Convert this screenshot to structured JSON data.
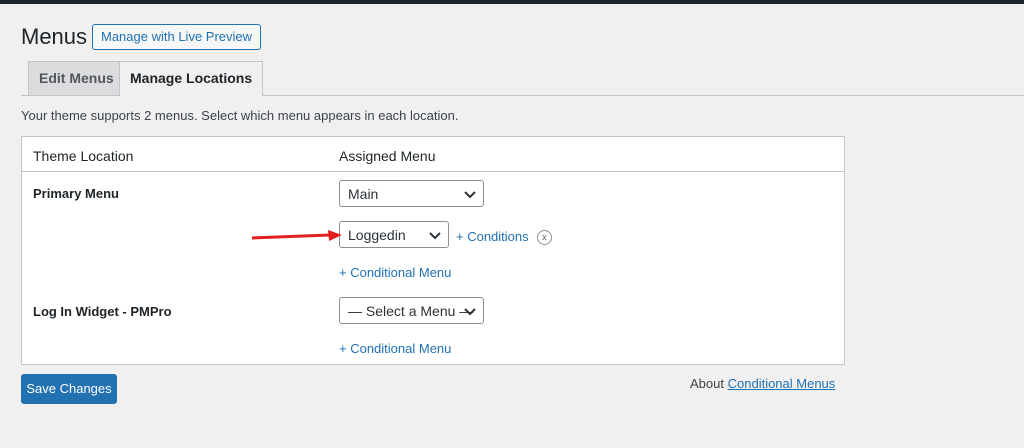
{
  "header": {
    "title": "Menus",
    "live_preview_label": "Manage with Live Preview"
  },
  "tabs": [
    {
      "label": "Edit Menus",
      "active": false
    },
    {
      "label": "Manage Locations",
      "active": true
    }
  ],
  "description": "Your theme supports 2 menus. Select which menu appears in each location.",
  "table": {
    "col_location": "Theme Location",
    "col_assigned": "Assigned Menu",
    "rows": [
      {
        "location": "Primary Menu",
        "selected_menu": "Main",
        "conditional": {
          "selected_menu": "Loggedin",
          "conditions_label": "+ Conditions",
          "remove_label": "x"
        },
        "add_conditional_label": "+ Conditional Menu"
      },
      {
        "location": "Log In Widget - PMPro",
        "selected_menu": "— Select a Menu —",
        "add_conditional_label": "+ Conditional Menu"
      }
    ]
  },
  "footer": {
    "save_label": "Save Changes",
    "about_prefix": "About",
    "about_link": "Conditional Menus"
  },
  "colors": {
    "accent": "#2271b1",
    "annotation_arrow": "#e02020",
    "background": "#f0f0f1"
  },
  "icons": {
    "select_chevron": "chevron-down-icon",
    "annotation": "arrow-right-icon"
  }
}
